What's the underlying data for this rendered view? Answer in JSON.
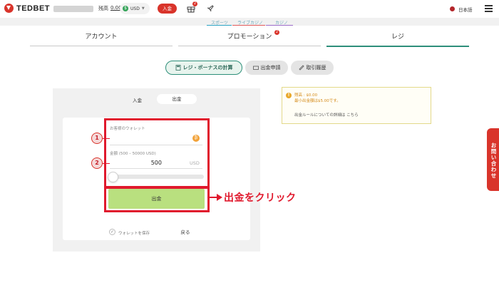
{
  "header": {
    "logo_text": "TEDBET",
    "balance_label": "残高",
    "balance_value": "0.00",
    "currency": "USD",
    "deposit_label": "入金",
    "gift_badge": "2",
    "language": "日本語"
  },
  "subnav": {
    "items": [
      {
        "label": "スポーツ",
        "color": "#2aa3c4"
      },
      {
        "label": "ライブカジノ",
        "color": "#e05a5a"
      },
      {
        "label": "カジノ",
        "color": "#9b6cc9"
      }
    ]
  },
  "tabs": [
    {
      "label": "アカウント",
      "active": false
    },
    {
      "label": "プロモーション",
      "active": false,
      "badge": "2"
    },
    {
      "label": "レジ",
      "active": true
    }
  ],
  "cashier_pills": [
    {
      "label": "レジ・ボーナスの計算",
      "icon": "calculator-icon",
      "active": true
    },
    {
      "label": "出金申請",
      "icon": "wallet-icon",
      "active": false
    },
    {
      "label": "取引履歴",
      "icon": "history-icon",
      "active": false
    }
  ],
  "form": {
    "deposit_tab": "入金",
    "withdraw_tab": "出金",
    "wallet_label": "お客様のウォレット",
    "amount_label": "金額 (500 – 50000 USD)",
    "amount_value": "500",
    "amount_unit": "USD",
    "slider_level": 0,
    "withdraw_button": "出金",
    "save_wallet_label": "ウォレットを保存",
    "back_button": "戻る"
  },
  "annotation": {
    "step1": "1",
    "step2": "2",
    "instruction": "出金をクリック",
    "color": "#e0192d"
  },
  "info": {
    "balance_line": "残高 : $0.00",
    "min_withdraw_line": "最小出金額は$5.00です。",
    "rule_text": "出金ルールについての詳細は こちら"
  },
  "contact_tab": "お問い合わせ"
}
